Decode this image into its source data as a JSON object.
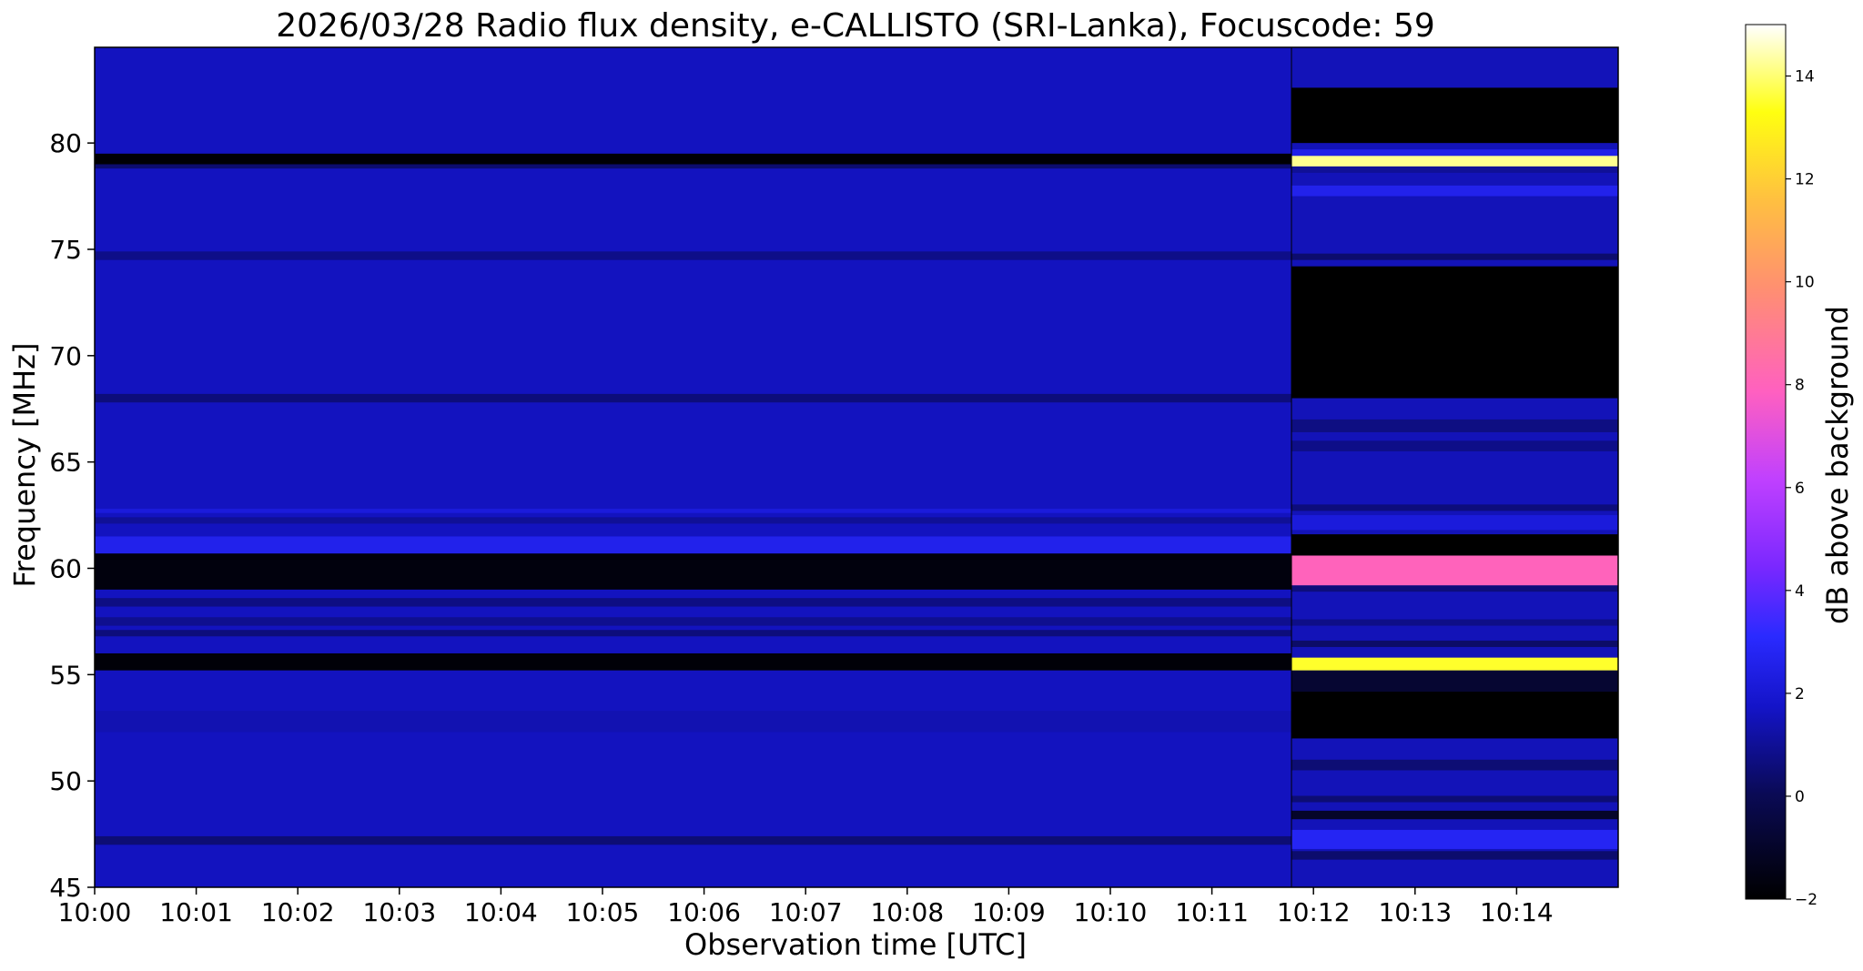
{
  "chart_data": {
    "type": "heatmap",
    "title": "2026/03/28  Radio flux density, e-CALLISTO (SRI-Lanka), Focuscode: 59",
    "xlabel": "Observation time [UTC]",
    "ylabel": "Frequency [MHz]",
    "colorbar_label": "dB above background",
    "colormap": "gnuplot2",
    "x_start": "10:00",
    "x_end": "10:15",
    "x_ticks": [
      "10:00",
      "10:01",
      "10:02",
      "10:03",
      "10:04",
      "10:05",
      "10:06",
      "10:07",
      "10:08",
      "10:09",
      "10:10",
      "10:11",
      "10:12",
      "10:13",
      "10:14"
    ],
    "ylim": [
      45,
      84.5
    ],
    "y_ticks": [
      45,
      50,
      55,
      60,
      65,
      70,
      75,
      80
    ],
    "clim": [
      -2,
      15
    ],
    "colorbar_ticks": [
      -2,
      0,
      2,
      4,
      6,
      8,
      10,
      12,
      14
    ],
    "segment_break": "10:11:47",
    "segments": [
      {
        "time_range": [
          "10:00",
          "10:11:47"
        ],
        "background_dB": 1.6,
        "bands": [
          {
            "freq": [
              47.0,
              47.4
            ],
            "dB": 0.5
          },
          {
            "freq": [
              52.3,
              53.3
            ],
            "dB": 1.4
          },
          {
            "freq": [
              55.2,
              56.0
            ],
            "dB": -1.8
          },
          {
            "freq": [
              56.8,
              57.1
            ],
            "dB": 0.6
          },
          {
            "freq": [
              57.3,
              57.7
            ],
            "dB": 0.9
          },
          {
            "freq": [
              58.2,
              58.6
            ],
            "dB": 0.7
          },
          {
            "freq": [
              59.0,
              60.7
            ],
            "dB": -1.7
          },
          {
            "freq": [
              60.7,
              61.5
            ],
            "dB": 2.6
          },
          {
            "freq": [
              62.1,
              62.4
            ],
            "dB": 1.0
          },
          {
            "freq": [
              62.6,
              62.8
            ],
            "dB": 2.2
          },
          {
            "freq": [
              67.8,
              68.2
            ],
            "dB": 0.6
          },
          {
            "freq": [
              74.5,
              74.9
            ],
            "dB": 0.8
          },
          {
            "freq": [
              78.8,
              79.0
            ],
            "dB": 0.4
          },
          {
            "freq": [
              79.0,
              79.5
            ],
            "dB": -1.9
          }
        ]
      },
      {
        "time_range": [
          "10:11:47",
          "10:15"
        ],
        "background_dB": 1.5,
        "bands": [
          {
            "freq": [
              46.3,
              46.7
            ],
            "dB": 0.4
          },
          {
            "freq": [
              46.8,
              47.7
            ],
            "dB": 2.8
          },
          {
            "freq": [
              48.2,
              48.6
            ],
            "dB": -1.0
          },
          {
            "freq": [
              49.0,
              49.3
            ],
            "dB": 0.5
          },
          {
            "freq": [
              50.5,
              51.0
            ],
            "dB": 0.5
          },
          {
            "freq": [
              52.0,
              54.2
            ],
            "dB": -2.0
          },
          {
            "freq": [
              54.2,
              55.2
            ],
            "dB": -0.8
          },
          {
            "freq": [
              55.2,
              55.8
            ],
            "dB": 13.5
          },
          {
            "freq": [
              56.3,
              56.6
            ],
            "dB": 0.3
          },
          {
            "freq": [
              57.3,
              57.6
            ],
            "dB": 0.8
          },
          {
            "freq": [
              58.9,
              59.2
            ],
            "dB": 0.6
          },
          {
            "freq": [
              59.2,
              60.6
            ],
            "dB": 8.0
          },
          {
            "freq": [
              60.6,
              61.6
            ],
            "dB": -2.0
          },
          {
            "freq": [
              61.8,
              62.5
            ],
            "dB": 2.2
          },
          {
            "freq": [
              62.7,
              63.0
            ],
            "dB": 0.6
          },
          {
            "freq": [
              65.5,
              66.0
            ],
            "dB": 0.8
          },
          {
            "freq": [
              66.4,
              67.0
            ],
            "dB": 0.7
          },
          {
            "freq": [
              68.0,
              74.2
            ],
            "dB": -2.0
          },
          {
            "freq": [
              74.5,
              74.8
            ],
            "dB": 0.4
          },
          {
            "freq": [
              77.5,
              78.0
            ],
            "dB": 2.6
          },
          {
            "freq": [
              78.6,
              78.9
            ],
            "dB": 1.0
          },
          {
            "freq": [
              78.9,
              79.4
            ],
            "dB": 14.2
          },
          {
            "freq": [
              79.4,
              79.7
            ],
            "dB": 2.5
          },
          {
            "freq": [
              80.0,
              82.6
            ],
            "dB": -2.0
          }
        ]
      }
    ]
  }
}
